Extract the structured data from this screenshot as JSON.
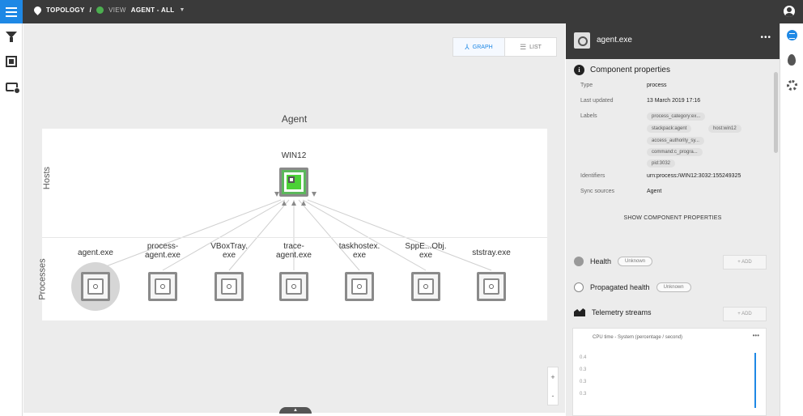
{
  "topbar": {
    "breadcrumb_root": "TOPOLOGY",
    "separator": "/",
    "view_prefix": "VIEW",
    "view_name": "AGENT - ALL",
    "status_color": "#4caf50"
  },
  "toggle": {
    "graph_label": "GRAPH",
    "list_label": "LIST"
  },
  "graph": {
    "layer_title": "Agent",
    "row_hosts": "Hosts",
    "row_processes": "Processes",
    "host": {
      "label": "WIN12"
    },
    "processes": [
      {
        "label_line1": "agent.exe",
        "label_line2": "",
        "selected": true
      },
      {
        "label_line1": "process-",
        "label_line2": "agent.exe",
        "selected": false
      },
      {
        "label_line1": "VBoxTray.",
        "label_line2": "exe",
        "selected": false
      },
      {
        "label_line1": "trace-",
        "label_line2": "agent.exe",
        "selected": false
      },
      {
        "label_line1": "taskhostex.",
        "label_line2": "exe",
        "selected": false
      },
      {
        "label_line1": "SppE...Obj.",
        "label_line2": "exe",
        "selected": false
      },
      {
        "label_line1": "ststray.exe",
        "label_line2": "",
        "selected": false
      }
    ],
    "zoom": {
      "in": "+",
      "out": "-"
    }
  },
  "panel": {
    "title": "agent.exe",
    "more": "•••",
    "section_title": "Component properties",
    "props": {
      "type_key": "Type",
      "type_val": "process",
      "updated_key": "Last updated",
      "updated_val": "13 March 2019 17:16",
      "labels_key": "Labels",
      "identifiers_key": "Identifiers",
      "identifiers_val": "urn:process:/WIN12:3032:155249325",
      "sync_key": "Sync sources",
      "sync_val": "Agent"
    },
    "labels": [
      "process_category:ex...",
      "stackpack:agent",
      "host:win12",
      "access_authority_sy...",
      "command:c_progra...",
      "pid:3032"
    ],
    "show_more": "SHOW COMPONENT PROPERTIES",
    "health_label": "Health",
    "health_status": "Unknown",
    "propagated_label": "Propagated health",
    "propagated_status": "Unknown",
    "add_label": "+ ADD",
    "telemetry_label": "Telemetry streams",
    "chart_title": "CPU time - System (percentage / second)",
    "chart_more": "•••",
    "chart_ticks": [
      "0.4",
      "0.3",
      "0.3",
      "0.3"
    ]
  },
  "chart_data": {
    "type": "line",
    "title": "CPU time - System (percentage / second)",
    "y_ticks": [
      "0.4",
      "0.3",
      "0.3",
      "0.3"
    ]
  }
}
